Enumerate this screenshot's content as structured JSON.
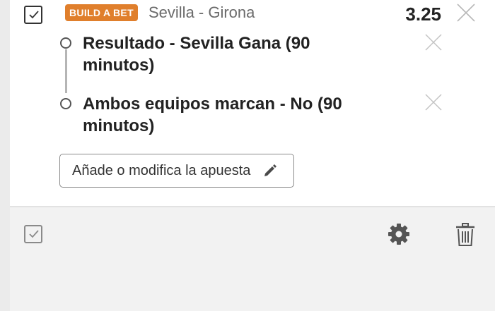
{
  "bet": {
    "badge_label": "BUILD A BET",
    "match": "Sevilla - Girona",
    "odds": "3.25",
    "selections": [
      {
        "label": "Resultado - Sevilla Gana (90 minutos)"
      },
      {
        "label": "Ambos equipos marcan - No (90 minutos)"
      }
    ],
    "edit_label": "Añade o modifica la apuesta"
  },
  "icons": {
    "main_checkbox": "checkbox-checked-icon",
    "close": "close-icon",
    "edit": "pencil-icon",
    "settings": "gear-icon",
    "delete": "trash-icon"
  },
  "colors": {
    "badge": "#e07f2c",
    "text_primary": "#222222",
    "text_secondary": "#6a6a6a",
    "icon": "#555555"
  }
}
